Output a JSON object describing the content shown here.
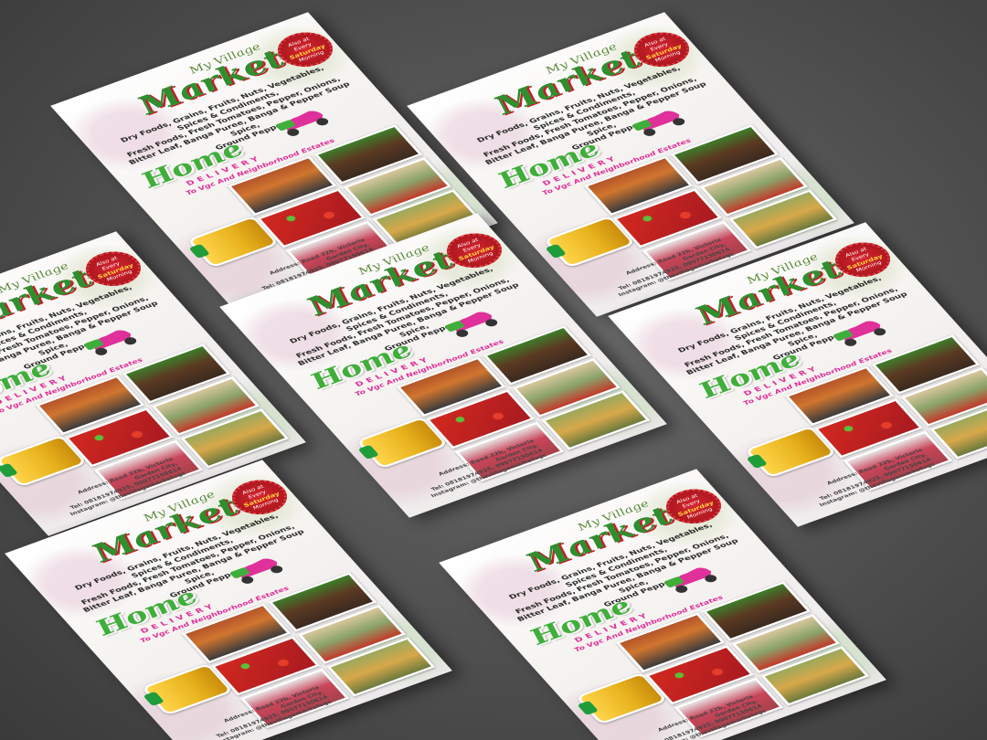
{
  "flyer": {
    "brand_top": "My Village",
    "brand_main": "Market",
    "brand_side": "Vgc",
    "badge_line1": "Also at",
    "badge_line2": "Every",
    "badge_line3": "Saturday",
    "badge_line4": "Morning",
    "products_line1": "Dry Foods, Grains, Fruits, Nuts, Vegetables, Spices & Condiments,",
    "products_line2": "Fresh Foods, Fresh Tomatoes, Pepper, Onions,",
    "products_line3": "Bitter Leaf, Banga Puree, Banga & Pepper Soup Spice,",
    "products_line4": "Ground Pepper",
    "home": "Home",
    "delivery": "DELIVERY",
    "tagline": "To Vgc And Neighborhood Estates",
    "address_line1": "Address: Road 22b, Victoria Garden City,",
    "address_line2": "Tel: 08181974925, 09077150614",
    "address_line3": "Instagram: @thevillagemarketvgc"
  },
  "colors": {
    "background": "#4f4f4f",
    "brand_green": "#2f8f2f",
    "accent_red": "#c21f2b",
    "accent_pink": "#e0309a"
  }
}
